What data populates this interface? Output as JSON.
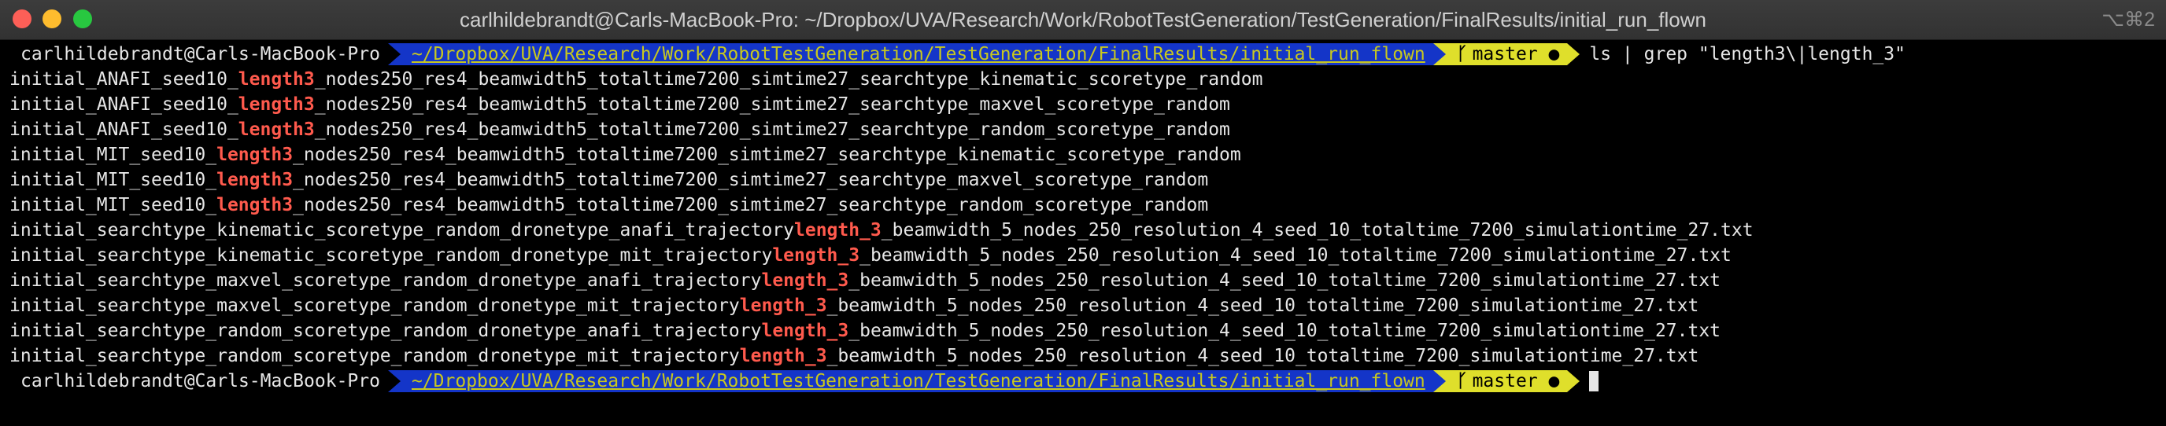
{
  "window": {
    "title": "carlhildebrandt@Carls-MacBook-Pro: ~/Dropbox/UVA/Research/Work/RobotTestGeneration/TestGeneration/FinalResults/initial_run_flown",
    "shortcut": "⌥⌘2"
  },
  "prompt": {
    "user": "carlhildebrandt@Carls-MacBook-Pro",
    "directory": "~/Dropbox/UVA/Research/Work/RobotTestGeneration/TestGeneration/FinalResults/initial_run_flown",
    "branch_icon": "git-branch-icon",
    "branch": "master",
    "status_dot": "●"
  },
  "command": "ls | grep \"length3\\|length_3\"",
  "output": [
    {
      "pre": "initial_ANAFI_seed10_",
      "match": "length3",
      "post": "_nodes250_res4_beamwidth5_totaltime7200_simtime27_searchtype_kinematic_scoretype_random"
    },
    {
      "pre": "initial_ANAFI_seed10_",
      "match": "length3",
      "post": "_nodes250_res4_beamwidth5_totaltime7200_simtime27_searchtype_maxvel_scoretype_random"
    },
    {
      "pre": "initial_ANAFI_seed10_",
      "match": "length3",
      "post": "_nodes250_res4_beamwidth5_totaltime7200_simtime27_searchtype_random_scoretype_random"
    },
    {
      "pre": "initial_MIT_seed10_",
      "match": "length3",
      "post": "_nodes250_res4_beamwidth5_totaltime7200_simtime27_searchtype_kinematic_scoretype_random"
    },
    {
      "pre": "initial_MIT_seed10_",
      "match": "length3",
      "post": "_nodes250_res4_beamwidth5_totaltime7200_simtime27_searchtype_maxvel_scoretype_random"
    },
    {
      "pre": "initial_MIT_seed10_",
      "match": "length3",
      "post": "_nodes250_res4_beamwidth5_totaltime7200_simtime27_searchtype_random_scoretype_random"
    },
    {
      "pre": "initial_searchtype_kinematic_scoretype_random_dronetype_anafi_trajectory",
      "match": "length_3",
      "post": "_beamwidth_5_nodes_250_resolution_4_seed_10_totaltime_7200_simulationtime_27.txt"
    },
    {
      "pre": "initial_searchtype_kinematic_scoretype_random_dronetype_mit_trajectory",
      "match": "length_3",
      "post": "_beamwidth_5_nodes_250_resolution_4_seed_10_totaltime_7200_simulationtime_27.txt"
    },
    {
      "pre": "initial_searchtype_maxvel_scoretype_random_dronetype_anafi_trajectory",
      "match": "length_3",
      "post": "_beamwidth_5_nodes_250_resolution_4_seed_10_totaltime_7200_simulationtime_27.txt"
    },
    {
      "pre": "initial_searchtype_maxvel_scoretype_random_dronetype_mit_trajectory",
      "match": "length_3",
      "post": "_beamwidth_5_nodes_250_resolution_4_seed_10_totaltime_7200_simulationtime_27.txt"
    },
    {
      "pre": "initial_searchtype_random_scoretype_random_dronetype_anafi_trajectory",
      "match": "length_3",
      "post": "_beamwidth_5_nodes_250_resolution_4_seed_10_totaltime_7200_simulationtime_27.txt"
    },
    {
      "pre": "initial_searchtype_random_scoretype_random_dronetype_mit_trajectory",
      "match": "length_3",
      "post": "_beamwidth_5_nodes_250_resolution_4_seed_10_totaltime_7200_simulationtime_27.txt"
    }
  ],
  "colors": {
    "match": "#ff5a4d",
    "dir_bg": "#1435c8",
    "dir_fg": "#c8c81e",
    "git_bg": "#dfdf2b"
  }
}
